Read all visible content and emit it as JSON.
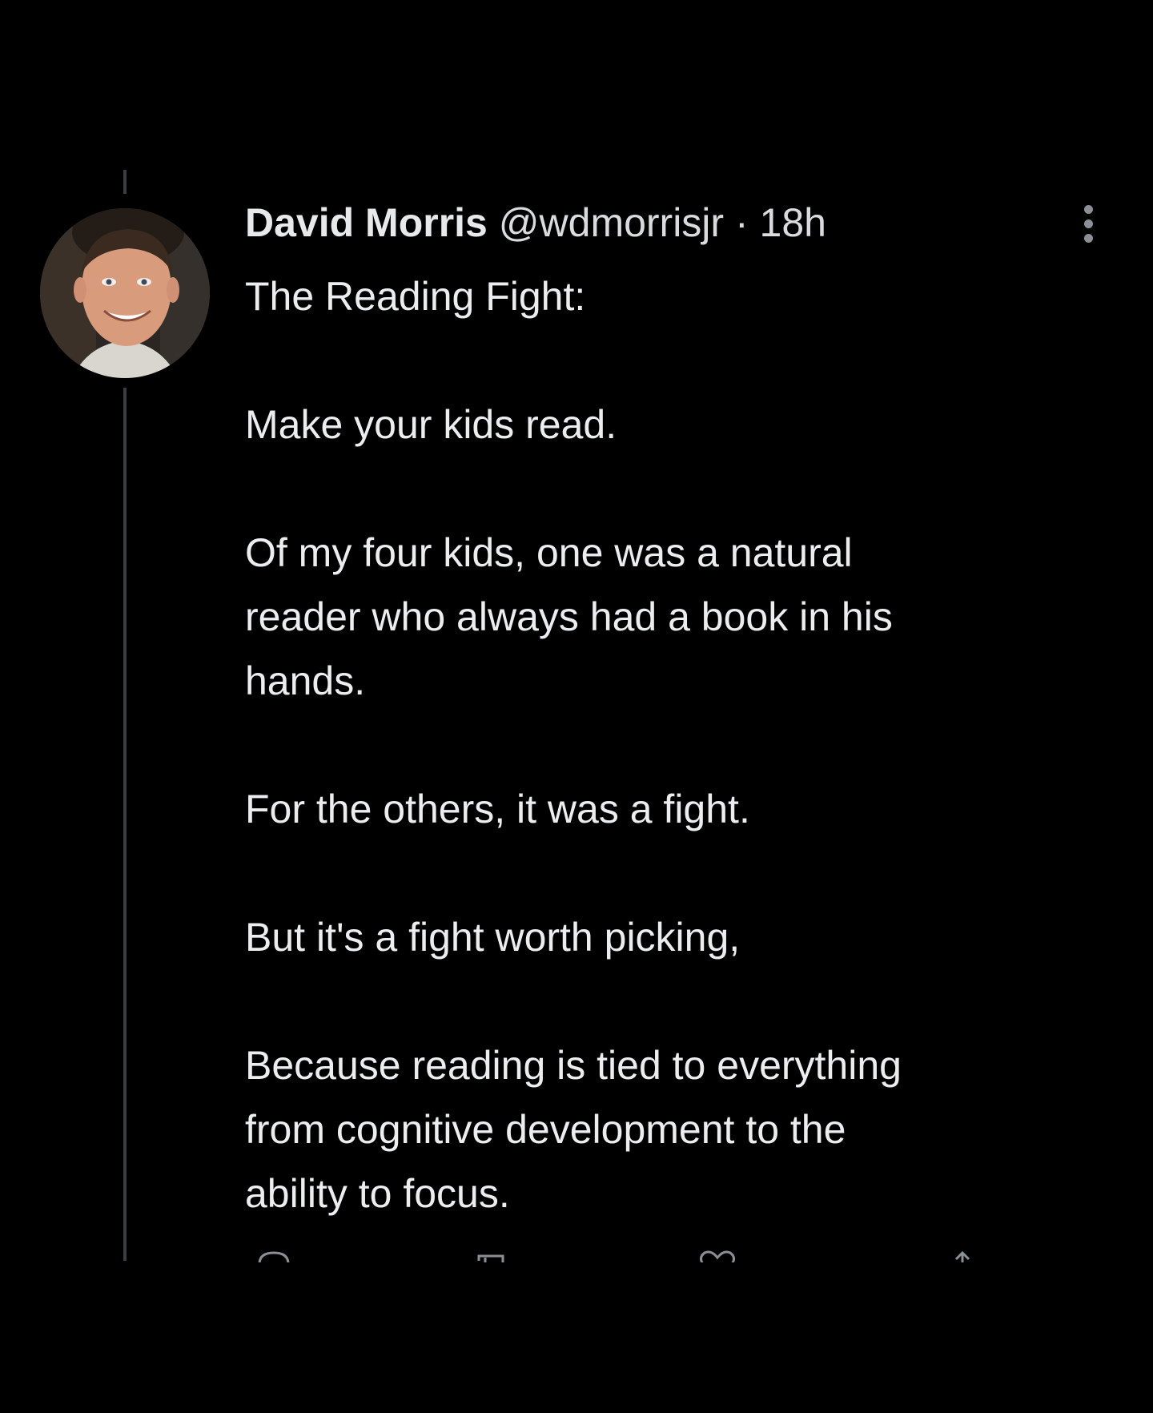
{
  "tweet": {
    "author_name": "David Morris",
    "handle": "@wdmorrisjr",
    "separator": "·",
    "time": "18h",
    "body": {
      "p1": "The Reading Fight:",
      "p2": "Make your kids read.",
      "p3_line1": "Of my four kids, one was a natural",
      "p3_line2": "reader who always had a book in his",
      "p3_line3": "hands.",
      "p4": "For the others, it was a fight.",
      "p5": "But it's a fight worth picking,",
      "p6_line1": "Because reading is tied to everything",
      "p6_line2": "from cognitive development to the",
      "p6_line3": "ability to focus."
    }
  },
  "icons": {
    "avatar": "profile-photo",
    "more": "more-vertical-icon",
    "reply": "reply-icon",
    "retweet": "retweet-icon",
    "like": "heart-icon",
    "share": "share-icon"
  },
  "colors": {
    "background": "#000000",
    "text": "#e7e9ea",
    "secondary": "#d9dbde",
    "thread_line": "#3a3d41",
    "icon_gray": "#8b9096"
  }
}
